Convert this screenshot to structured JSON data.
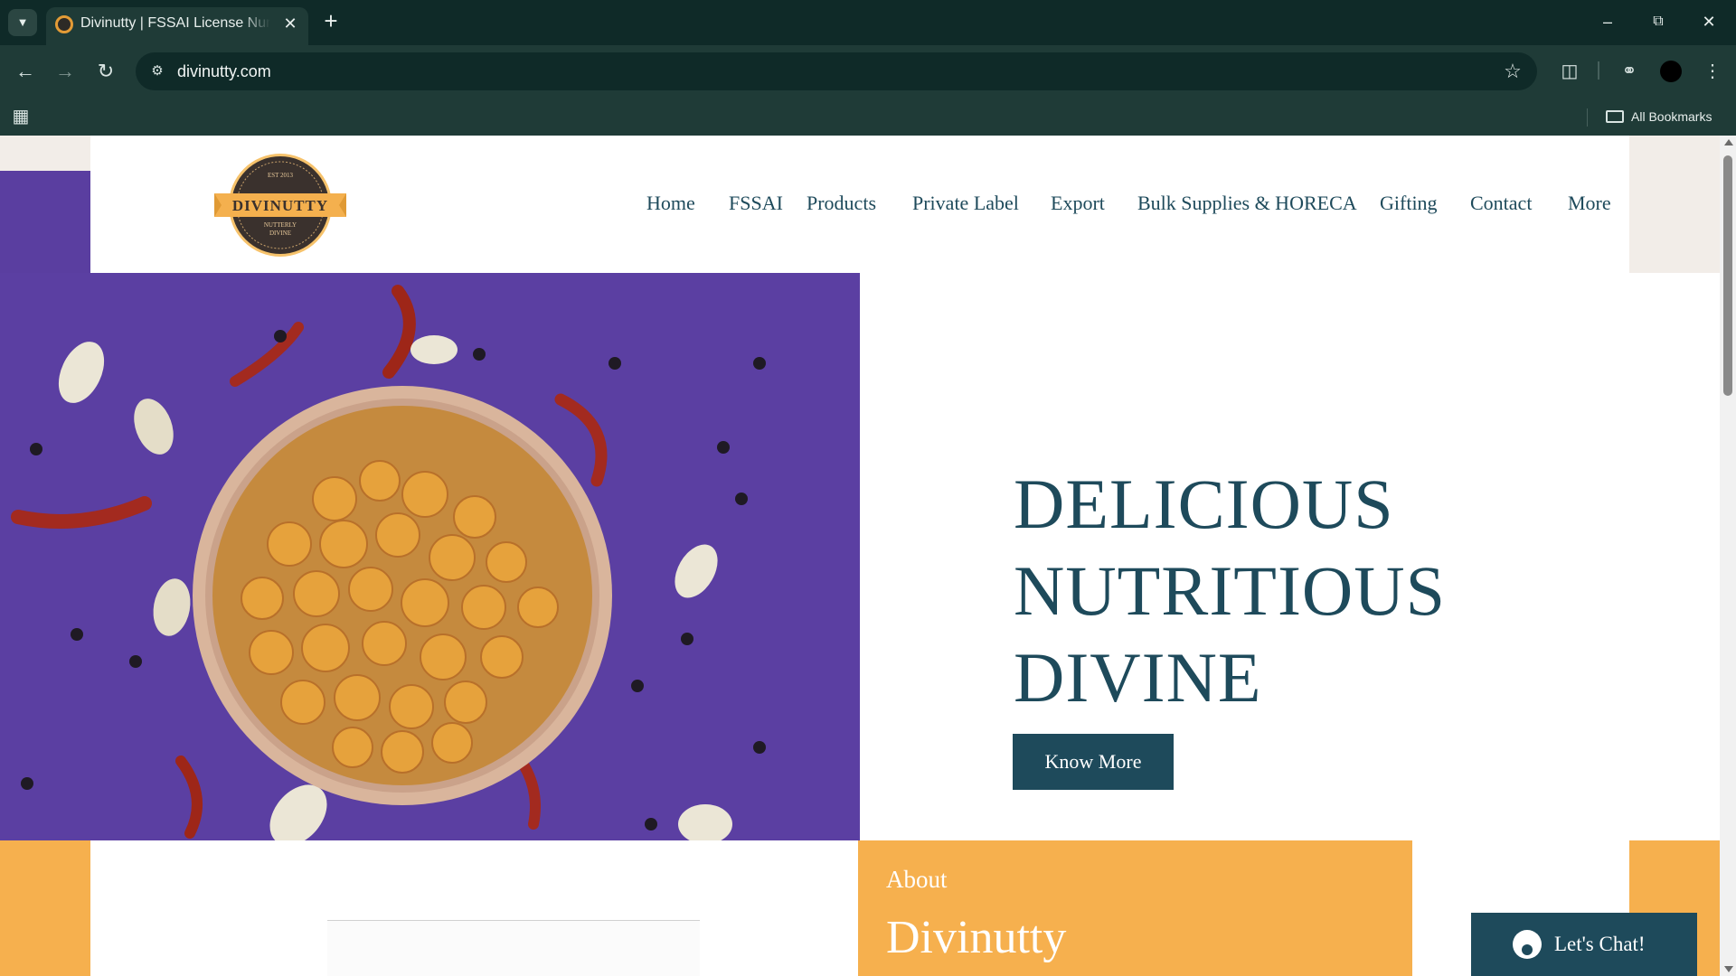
{
  "browser": {
    "tab_title": "Divinutty | FSSAI License Number",
    "url": "divinutty.com",
    "bookmarks_label": "All Bookmarks",
    "icons": {
      "tab_list": "chevron-down-icon",
      "close_tab": "close-icon",
      "new_tab": "plus-icon",
      "back": "back-arrow-icon",
      "forward": "forward-arrow-icon",
      "reload": "reload-icon",
      "site_info": "tune-icon",
      "bookmark": "star-icon",
      "extensions": "puzzle-icon",
      "performance": "speedometer-icon",
      "menu": "kebab-menu-icon",
      "apps": "apps-grid-icon",
      "folder": "folder-icon"
    }
  },
  "site": {
    "logo": {
      "top_text": "EST 2013",
      "brand": "DIVINUTTY",
      "tagline_1": "NUTTERLY",
      "tagline_2": "DIVINE"
    },
    "nav": [
      "Home",
      "FSSAI",
      "Products",
      "Private Label",
      "Export",
      "Bulk Supplies & HORECA",
      "Gifting",
      "Contact",
      "More"
    ],
    "hero": {
      "lines": [
        "DELICIOUS",
        "NUTRITIOUS",
        "DIVINE"
      ],
      "cta": "Know More"
    },
    "about": {
      "label": "About",
      "title": "Divinutty"
    },
    "chat": {
      "label": "Let's Chat!"
    }
  },
  "colors": {
    "brand_dark": "#1e4a5b",
    "purple": "#5a3ea0",
    "orange": "#f6b04e",
    "chrome_dark": "#0f2a28",
    "chrome": "#1f3b37"
  }
}
